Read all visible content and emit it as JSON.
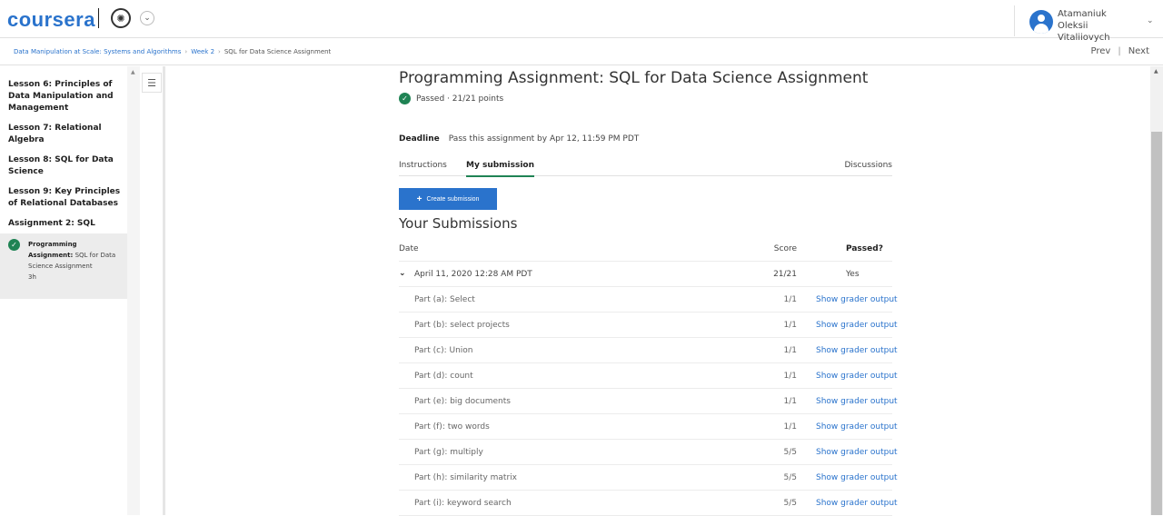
{
  "header": {
    "logo": "coursera",
    "user_name": "Atamaniuk Oleksii Vitaliiovych"
  },
  "breadcrumb": {
    "course": "Data Manipulation at Scale: Systems and Algorithms",
    "week": "Week 2",
    "current": "SQL for Data Science Assignment"
  },
  "nav": {
    "prev": "Prev",
    "separator": "|",
    "next": "Next"
  },
  "sidebar": {
    "items": [
      {
        "label": "Lesson 6: Principles of Data Manipulation and Management"
      },
      {
        "label": "Lesson 7: Relational Algebra"
      },
      {
        "label": "Lesson 8: SQL for Data Science"
      },
      {
        "label": "Lesson 9: Key Principles of Relational Databases"
      },
      {
        "label": "Assignment 2: SQL"
      }
    ],
    "active": {
      "type": "Programming Assignment:",
      "title": "SQL for Data Science Assignment",
      "duration": "3h"
    }
  },
  "main": {
    "title": "Programming Assignment: SQL for Data Science Assignment",
    "status": "Passed · 21/21 points",
    "deadline_label": "Deadline",
    "deadline_text": "Pass this assignment by Apr 12, 11:59 PM PDT",
    "tabs": [
      {
        "label": "Instructions"
      },
      {
        "label": "My submission"
      },
      {
        "label": "Discussions"
      }
    ],
    "create_button": "Create submission",
    "submissions_title": "Your Submissions",
    "columns": {
      "date": "Date",
      "score": "Score",
      "passed": "Passed?"
    },
    "submission": {
      "date": "April 11, 2020 12:28 AM PDT",
      "score": "21/21",
      "passed": "Yes"
    },
    "parts": [
      {
        "name": "Part (a): Select",
        "score": "1/1",
        "link": "Show grader output"
      },
      {
        "name": "Part (b): select projects",
        "score": "1/1",
        "link": "Show grader output"
      },
      {
        "name": "Part (c): Union",
        "score": "1/1",
        "link": "Show grader output"
      },
      {
        "name": "Part (d): count",
        "score": "1/1",
        "link": "Show grader output"
      },
      {
        "name": "Part (e): big documents",
        "score": "1/1",
        "link": "Show grader output"
      },
      {
        "name": "Part (f): two words",
        "score": "1/1",
        "link": "Show grader output"
      },
      {
        "name": "Part (g): multiply",
        "score": "5/5",
        "link": "Show grader output"
      },
      {
        "name": "Part (h): similarity matrix",
        "score": "5/5",
        "link": "Show grader output"
      },
      {
        "name": "Part (i): keyword search",
        "score": "5/5",
        "link": "Show grader output"
      }
    ]
  },
  "colors": {
    "brand": "#2a73cc",
    "success": "#1f8354"
  }
}
